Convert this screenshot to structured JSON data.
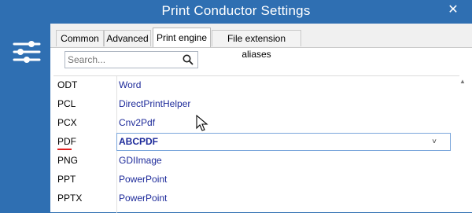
{
  "window": {
    "title": "Print Conductor Settings",
    "close_glyph": "✕"
  },
  "tabs": [
    {
      "label": "Common"
    },
    {
      "label": "Advanced"
    },
    {
      "label": "Print engine",
      "active": true
    },
    {
      "label": "File extension aliases"
    }
  ],
  "search": {
    "placeholder": "Search..."
  },
  "grid": {
    "rows": [
      {
        "extension": "ODT",
        "engine": "Word"
      },
      {
        "extension": "PCL",
        "engine": "DirectPrintHelper"
      },
      {
        "extension": "PCX",
        "engine": "Cnv2Pdf"
      },
      {
        "extension": "PDF",
        "engine": "ABCPDF",
        "selected": true
      },
      {
        "extension": "PNG",
        "engine": "GDIImage"
      },
      {
        "extension": "PPT",
        "engine": "PowerPoint"
      },
      {
        "extension": "PPTX",
        "engine": "PowerPoint"
      }
    ]
  },
  "colors": {
    "accent": "#2f6fb2",
    "engine_text": "#1d2a9a",
    "underline": "#e01f1f"
  },
  "icons": {
    "sidebar": "settings-sliders-icon",
    "search": "search-icon",
    "close": "close-icon",
    "dropdown": "chevron-down-icon",
    "cursor": "mouse-cursor-icon"
  }
}
